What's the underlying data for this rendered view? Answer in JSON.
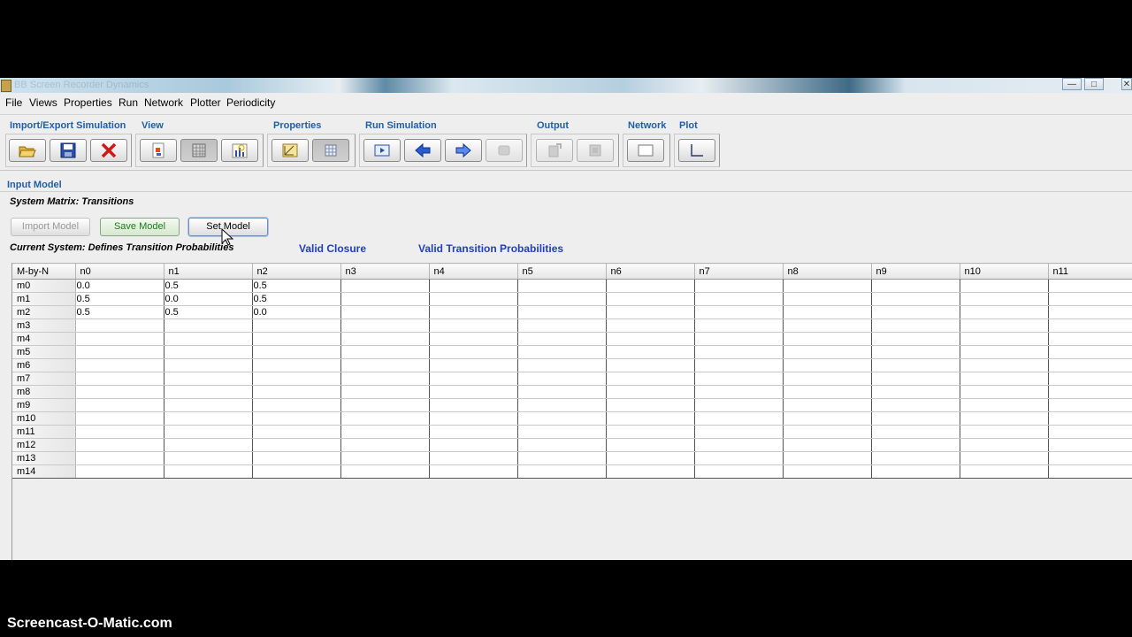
{
  "window": {
    "title": "BB Screen Recorder Dynamics",
    "controls": {
      "minimize": "—",
      "maximize": "□",
      "close": "✕"
    }
  },
  "menu": [
    "File",
    "Views",
    "Properties",
    "Run",
    "Network",
    "Plotter",
    "Periodicity"
  ],
  "toolbar": {
    "groups": {
      "import_export": "Import/Export Simulation",
      "view": "View",
      "properties": "Properties",
      "run_simulation": "Run Simulation",
      "output": "Output",
      "network": "Network",
      "plot": "Plot"
    },
    "icons": {
      "open": "folder-open-icon",
      "save": "floppy-disk-icon",
      "close": "red-x-icon",
      "document": "document-icon",
      "grid": "grid-view-icon",
      "chart": "chart-icon",
      "ruler": "ruler-icon",
      "table": "table-icon",
      "play": "play-icon",
      "back": "back-arrow-icon",
      "forward": "forward-arrow-icon",
      "stop": "stop-icon"
    }
  },
  "input_model": {
    "section_title": "Input Model",
    "system_matrix_title": "System Matrix: Transitions",
    "buttons": {
      "import_model": "Import Model",
      "save_model": "Save Model",
      "set_model": "Set Model"
    },
    "current_system": "Current System: Defines Transition Probabilities",
    "valid_closure": "Valid Closure",
    "valid_transition": "Valid Transition Probabilities"
  },
  "matrix": {
    "corner": "M-by-N",
    "columns": [
      "n0",
      "n1",
      "n2",
      "n3",
      "n4",
      "n5",
      "n6",
      "n7",
      "n8",
      "n9",
      "n10",
      "n11"
    ],
    "rows": [
      {
        "label": "m0",
        "cells": [
          "0.0",
          "0.5",
          "0.5",
          "",
          "",
          "",
          "",
          "",
          "",
          "",
          "",
          ""
        ]
      },
      {
        "label": "m1",
        "cells": [
          "0.5",
          "0.0",
          "0.5",
          "",
          "",
          "",
          "",
          "",
          "",
          "",
          "",
          ""
        ]
      },
      {
        "label": "m2",
        "cells": [
          "0.5",
          "0.5",
          "0.0",
          "",
          "",
          "",
          "",
          "",
          "",
          "",
          "",
          ""
        ]
      },
      {
        "label": "m3",
        "cells": [
          "",
          "",
          "",
          "",
          "",
          "",
          "",
          "",
          "",
          "",
          "",
          ""
        ]
      },
      {
        "label": "m4",
        "cells": [
          "",
          "",
          "",
          "",
          "",
          "",
          "",
          "",
          "",
          "",
          "",
          ""
        ]
      },
      {
        "label": "m5",
        "cells": [
          "",
          "",
          "",
          "",
          "",
          "",
          "",
          "",
          "",
          "",
          "",
          ""
        ]
      },
      {
        "label": "m6",
        "cells": [
          "",
          "",
          "",
          "",
          "",
          "",
          "",
          "",
          "",
          "",
          "",
          ""
        ]
      },
      {
        "label": "m7",
        "cells": [
          "",
          "",
          "",
          "",
          "",
          "",
          "",
          "",
          "",
          "",
          "",
          ""
        ]
      },
      {
        "label": "m8",
        "cells": [
          "",
          "",
          "",
          "",
          "",
          "",
          "",
          "",
          "",
          "",
          "",
          ""
        ]
      },
      {
        "label": "m9",
        "cells": [
          "",
          "",
          "",
          "",
          "",
          "",
          "",
          "",
          "",
          "",
          "",
          ""
        ]
      },
      {
        "label": "m10",
        "cells": [
          "",
          "",
          "",
          "",
          "",
          "",
          "",
          "",
          "",
          "",
          "",
          ""
        ]
      },
      {
        "label": "m11",
        "cells": [
          "",
          "",
          "",
          "",
          "",
          "",
          "",
          "",
          "",
          "",
          "",
          ""
        ]
      },
      {
        "label": "m12",
        "cells": [
          "",
          "",
          "",
          "",
          "",
          "",
          "",
          "",
          "",
          "",
          "",
          ""
        ]
      },
      {
        "label": "m13",
        "cells": [
          "",
          "",
          "",
          "",
          "",
          "",
          "",
          "",
          "",
          "",
          "",
          ""
        ]
      },
      {
        "label": "m14",
        "cells": [
          "",
          "",
          "",
          "",
          "",
          "",
          "",
          "",
          "",
          "",
          "",
          ""
        ]
      }
    ]
  },
  "watermark": "Screencast-O-Matic.com",
  "colors": {
    "section_blue": "#1f5fa8",
    "status_blue": "#1f3fbf",
    "save_green": "#1a7a1a"
  }
}
